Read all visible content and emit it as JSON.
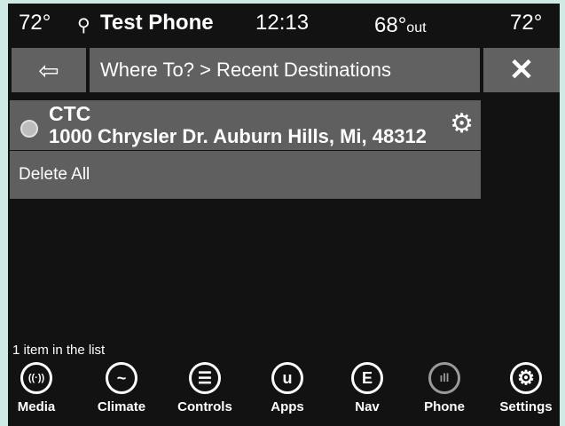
{
  "status": {
    "temp_left": "72°",
    "usb_icon": "⚲",
    "phone_name": "Test Phone",
    "time": "12:13",
    "outside_temp": "68°",
    "outside_suffix": "out",
    "temp_right": "72°"
  },
  "navbar": {
    "back_icon": "⇦",
    "breadcrumb": "Where To? > Recent Destinations",
    "close_icon": "✕"
  },
  "list": {
    "items": [
      {
        "name": "CTC",
        "address": "1000 Chrysler Dr. Auburn Hills, Mi, 48312",
        "gear_icon": "⚙"
      }
    ],
    "delete_all_label": "Delete All",
    "count_text": "1 item in the list"
  },
  "dock": {
    "items": [
      {
        "label": "Media",
        "icon": "((·))"
      },
      {
        "label": "Climate",
        "icon": "~"
      },
      {
        "label": "Controls",
        "icon": "☰"
      },
      {
        "label": "Apps",
        "icon": "u"
      },
      {
        "label": "Nav",
        "icon": "E"
      },
      {
        "label": "Phone",
        "icon": "ıll"
      },
      {
        "label": "Settings",
        "icon": "⚙"
      }
    ]
  },
  "colors": {
    "background": "#121212",
    "button": "#5f5f5f",
    "frame": "#cfe9e4"
  }
}
